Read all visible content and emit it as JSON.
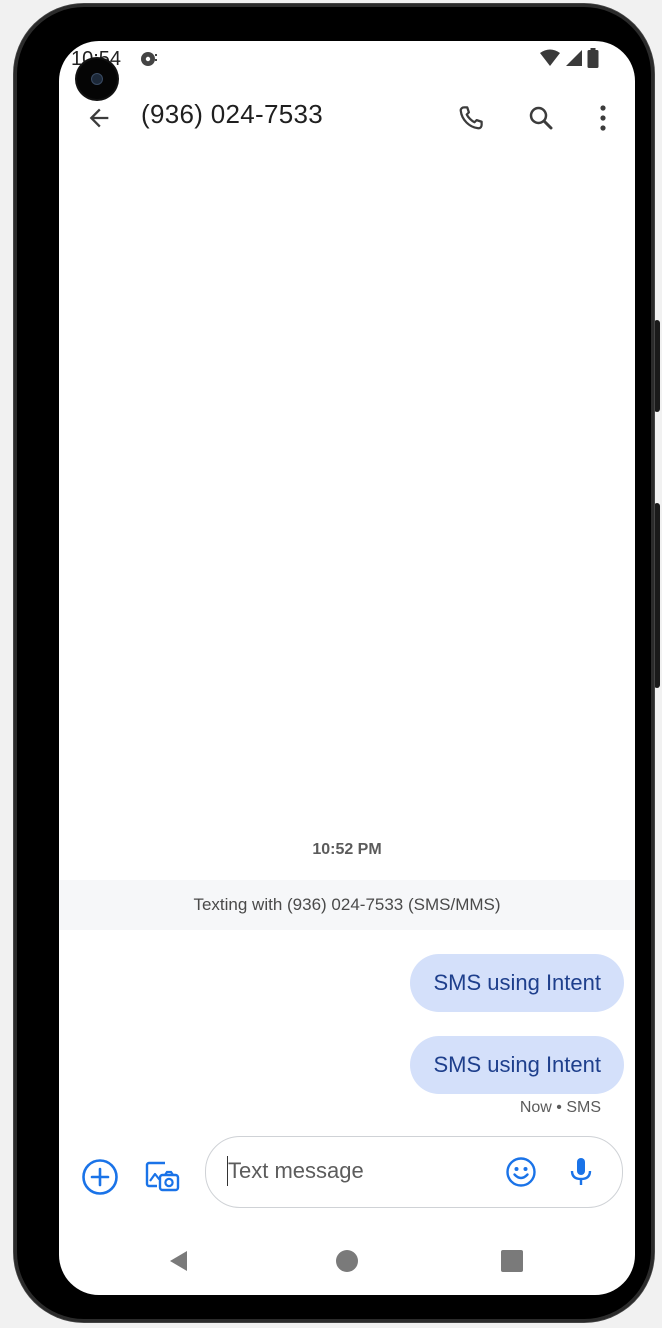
{
  "status_bar": {
    "time": "10:54",
    "icons": [
      "media-icon",
      "wifi-icon",
      "signal-icon",
      "battery-icon"
    ]
  },
  "app_bar": {
    "title": "(936) 024-7533",
    "icons": [
      "back-arrow-icon",
      "phone-icon",
      "search-icon",
      "more-vert-icon"
    ]
  },
  "conversation": {
    "timestamp": "10:52 PM",
    "info_banner": "Texting with (936) 024-7533 (SMS/MMS)",
    "messages": [
      {
        "text": "SMS using Intent"
      },
      {
        "text": "SMS using Intent"
      }
    ],
    "last_meta": "Now • SMS"
  },
  "composer": {
    "placeholder": "Text message",
    "icons": [
      "add-circle-icon",
      "gallery-camera-icon",
      "emoji-icon",
      "mic-icon"
    ]
  },
  "nav_bar": {
    "icons": [
      "nav-back-icon",
      "nav-home-icon",
      "nav-recents-icon"
    ]
  },
  "colors": {
    "accent": "#1a73e8",
    "bubble": "#d4e0fa",
    "bubble_text": "#1e3f8c",
    "banner": "#f6f7f9"
  }
}
